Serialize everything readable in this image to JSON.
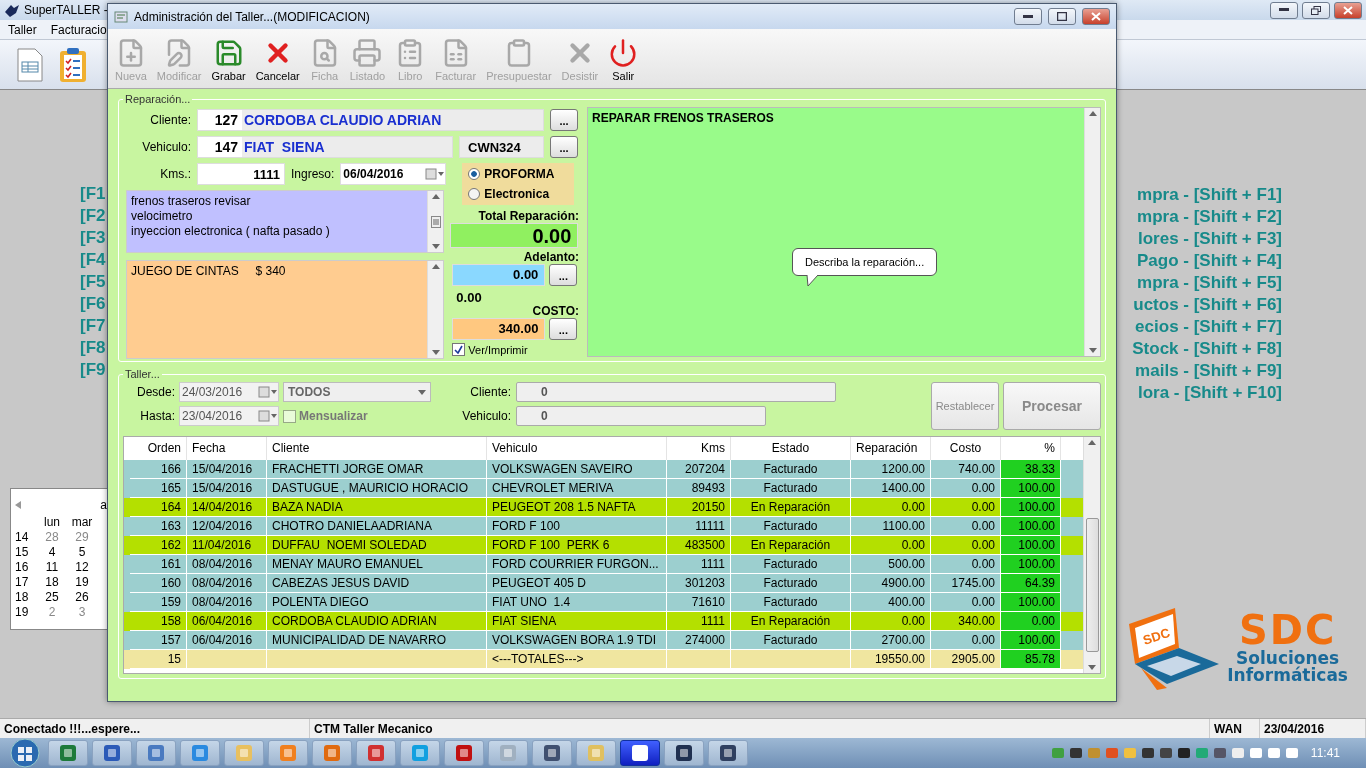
{
  "app": {
    "title": "SuperTALLER -",
    "menu": [
      "Taller",
      "Facturacio"
    ]
  },
  "shortcuts_left": [
    "[F1",
    "[F2",
    "[F3",
    "[F4",
    "[F5",
    "[F6",
    "[F7",
    "[F8",
    "[F9"
  ],
  "shortcuts_right": [
    "mpra - [Shift + F1]",
    "mpra - [Shift + F2]",
    "lores - [Shift + F3]",
    "Pago - [Shift + F4]",
    "mpra - [Shift + F5]",
    "uctos - [Shift + F6]",
    "ecios - [Shift + F7]",
    "Stock - [Shift + F8]",
    "mails - [Shift + F9]",
    "lora - [Shift + F10]"
  ],
  "calendar": {
    "title": "a",
    "weekdays": [
      "lun",
      "mar"
    ],
    "weeks": [
      {
        "week": "14",
        "days": [
          {
            "day": "28",
            "other_month": true
          },
          {
            "day": "29",
            "other_month": true
          }
        ]
      },
      {
        "week": "15",
        "days": [
          {
            "day": "4",
            "other_month": false
          },
          {
            "day": "5",
            "other_month": false
          }
        ]
      },
      {
        "week": "16",
        "days": [
          {
            "day": "11",
            "other_month": false
          },
          {
            "day": "12",
            "other_month": false
          }
        ]
      },
      {
        "week": "17",
        "days": [
          {
            "day": "18",
            "other_month": false
          },
          {
            "day": "19",
            "other_month": false
          }
        ]
      },
      {
        "week": "18",
        "days": [
          {
            "day": "25",
            "other_month": false
          },
          {
            "day": "26",
            "other_month": false
          }
        ]
      },
      {
        "week": "19",
        "days": [
          {
            "day": "2",
            "other_month": true
          },
          {
            "day": "3",
            "other_month": true
          }
        ]
      }
    ]
  },
  "logo": {
    "badge": "SDC",
    "name": "SDC",
    "line1": "Soluciones",
    "line2": "Informáticas"
  },
  "dialog": {
    "title": "Administración del Taller...(MODIFICACION)",
    "toolbar": [
      {
        "label": "Nueva",
        "kind": "new",
        "disabled": true
      },
      {
        "label": "Modificar",
        "kind": "edit",
        "disabled": true
      },
      {
        "label": "Grabar",
        "kind": "save",
        "disabled": false
      },
      {
        "label": "Cancelar",
        "kind": "cancel",
        "disabled": false
      },
      {
        "label": "Ficha",
        "kind": "search",
        "disabled": true
      },
      {
        "label": "Listado",
        "kind": "print",
        "disabled": true
      },
      {
        "label": "Libro",
        "kind": "book",
        "disabled": true
      },
      {
        "label": "Facturar",
        "kind": "invoice",
        "disabled": true
      },
      {
        "label": "Presupuestar",
        "kind": "clipboard",
        "disabled": true
      },
      {
        "label": "Desistir",
        "kind": "discard",
        "disabled": true
      },
      {
        "label": "Salir",
        "kind": "power",
        "disabled": false
      }
    ],
    "reparacion": {
      "legend": "Reparación...",
      "cliente": {
        "label": "Cliente:",
        "code": "127",
        "name": "CORDOBA CLAUDIO ADRIAN",
        "button": "..."
      },
      "vehiculo": {
        "label": "Vehiculo:",
        "code": "147",
        "name": "FIAT  SIENA",
        "plate": "CWN324",
        "button": "..."
      },
      "kms": {
        "label": "Kms.:",
        "value": "1111"
      },
      "ingreso": {
        "label": "Ingreso:",
        "value": "06/04/2016"
      },
      "notes": [
        "frenos traseros revisar",
        "velocimetro",
        "inyeccion electronica ( nafta pasado )"
      ],
      "parts": "JUEGO DE CINTAS     $ 340",
      "invoice_types": [
        {
          "label": "PROFORMA",
          "selected": true
        },
        {
          "label": "Electronica",
          "selected": false
        }
      ],
      "total": {
        "label": "Total Reparación:",
        "value": "0.00"
      },
      "adelanto": {
        "label": "Adelanto:",
        "value": "0.00",
        "button": "..."
      },
      "saldo": "0.00",
      "costo": {
        "label": "COSTO:",
        "value": "340.00",
        "button": "..."
      },
      "print": {
        "label": "Ver/Imprimir",
        "checked": true
      },
      "description": "REPARAR FRENOS TRASEROS",
      "tooltip": "Describa la reparación..."
    },
    "taller": {
      "legend": "Taller...",
      "desde": {
        "label": "Desde:",
        "value": "24/03/2016",
        "disabled": true
      },
      "hasta": {
        "label": "Hasta:",
        "value": "23/04/2016",
        "disabled": true
      },
      "estado_filter": {
        "value": "TODOS",
        "disabled": true
      },
      "mensualizar": {
        "label": "Mensualizar",
        "checked": false,
        "disabled": true
      },
      "cliente": {
        "label": "Cliente:",
        "value": "0"
      },
      "vehiculo": {
        "label": "Vehiculo:",
        "value": "0"
      },
      "buttons": [
        {
          "label": "Restablecer",
          "disabled": true
        },
        {
          "label": "Procesar",
          "disabled": true
        }
      ],
      "table": {
        "columns": [
          "Orden",
          "Fecha",
          "Cliente",
          "Vehiculo",
          "Kms",
          "Estado",
          "Reparación",
          "Costo",
          "%"
        ],
        "rows": [
          {
            "color": "#9ccfcf",
            "cells": [
              "166",
              "15/04/2016",
              "FRACHETTI JORGE OMAR",
              "VOLKSWAGEN SAVEIRO",
              "207204",
              "Facturado",
              "1200.00",
              "740.00",
              "38.33"
            ]
          },
          {
            "color": "#9ccfcf",
            "cells": [
              "165",
              "15/04/2016",
              "DASTUGUE , MAURICIO HORACIO",
              "CHEVROLET MERIVA",
              "89493",
              "Facturado",
              "1400.00",
              "0.00",
              "100.00"
            ]
          },
          {
            "color": "#b4e000",
            "cells": [
              "164",
              "14/04/2016",
              "BAZA NADIA",
              "PEUGEOT 208 1.5 NAFTA",
              "20150",
              "En Reparación",
              "0.00",
              "0.00",
              "100.00"
            ]
          },
          {
            "color": "#9ccfcf",
            "cells": [
              "163",
              "12/04/2016",
              "CHOTRO DANIELAADRIANA",
              "FORD F 100",
              "11111",
              "Facturado",
              "1100.00",
              "0.00",
              "100.00"
            ]
          },
          {
            "color": "#b4e000",
            "cells": [
              "162",
              "11/04/2016",
              "DUFFAU  NOEMI SOLEDAD",
              "FORD F 100  PERK 6",
              "483500",
              "En Reparación",
              "0.00",
              "0.00",
              "100.00"
            ]
          },
          {
            "color": "#9ccfcf",
            "cells": [
              "161",
              "08/04/2016",
              "MENAY MAURO EMANUEL",
              "FORD COURRIER FURGON...",
              "1111",
              "Facturado",
              "500.00",
              "0.00",
              "100.00"
            ]
          },
          {
            "color": "#9ccfcf",
            "cells": [
              "160",
              "08/04/2016",
              "CABEZAS JESUS DAVID",
              "PEUGEOT 405 D",
              "301203",
              "Facturado",
              "4900.00",
              "1745.00",
              "64.39"
            ]
          },
          {
            "color": "#9ccfcf",
            "cells": [
              "159",
              "08/04/2016",
              "POLENTA DIEGO",
              "FIAT UNO  1.4",
              "71610",
              "Facturado",
              "400.00",
              "0.00",
              "100.00"
            ]
          },
          {
            "color": "#b4e000",
            "cells": [
              "158",
              "06/04/2016",
              "CORDOBA CLAUDIO ADRIAN",
              "FIAT SIENA",
              "1111",
              "En Reparación",
              "0.00",
              "340.00",
              "0.00"
            ]
          },
          {
            "color": "#9ccfcf",
            "cells": [
              "157",
              "06/04/2016",
              "MUNICIPALIDAD DE NAVARRO",
              "VOLKSWAGEN BORA 1.9 TDI",
              "274000",
              "Facturado",
              "2700.00",
              "0.00",
              "100.00"
            ]
          }
        ],
        "totals": {
          "count": "15",
          "label": "<---TOTALES--->",
          "reparacion": "19550.00",
          "costo": "2905.00",
          "percent": "85.78"
        }
      }
    }
  },
  "status_bar": [
    "Conectado !!!...espere...",
    "CTM Taller Mecanico",
    "WAN",
    "23/04/2016"
  ],
  "taskbar": {
    "apps": [
      {
        "kind": "excel",
        "selected": false
      },
      {
        "kind": "word",
        "selected": false
      },
      {
        "kind": "feather",
        "selected": false
      },
      {
        "kind": "browser",
        "selected": false
      },
      {
        "kind": "folder",
        "selected": false
      },
      {
        "kind": "media",
        "selected": false
      },
      {
        "kind": "fox",
        "selected": false
      },
      {
        "kind": "chrome",
        "selected": false
      },
      {
        "kind": "skype",
        "selected": false
      },
      {
        "kind": "ftp",
        "selected": false
      },
      {
        "kind": "calc",
        "selected": false
      },
      {
        "kind": "arrow",
        "selected": false
      },
      {
        "kind": "windows",
        "selected": false
      },
      {
        "kind": "tower",
        "selected": true
      },
      {
        "kind": "window",
        "selected": false
      },
      {
        "kind": "bird",
        "selected": false
      }
    ],
    "clock": "11:41"
  }
}
